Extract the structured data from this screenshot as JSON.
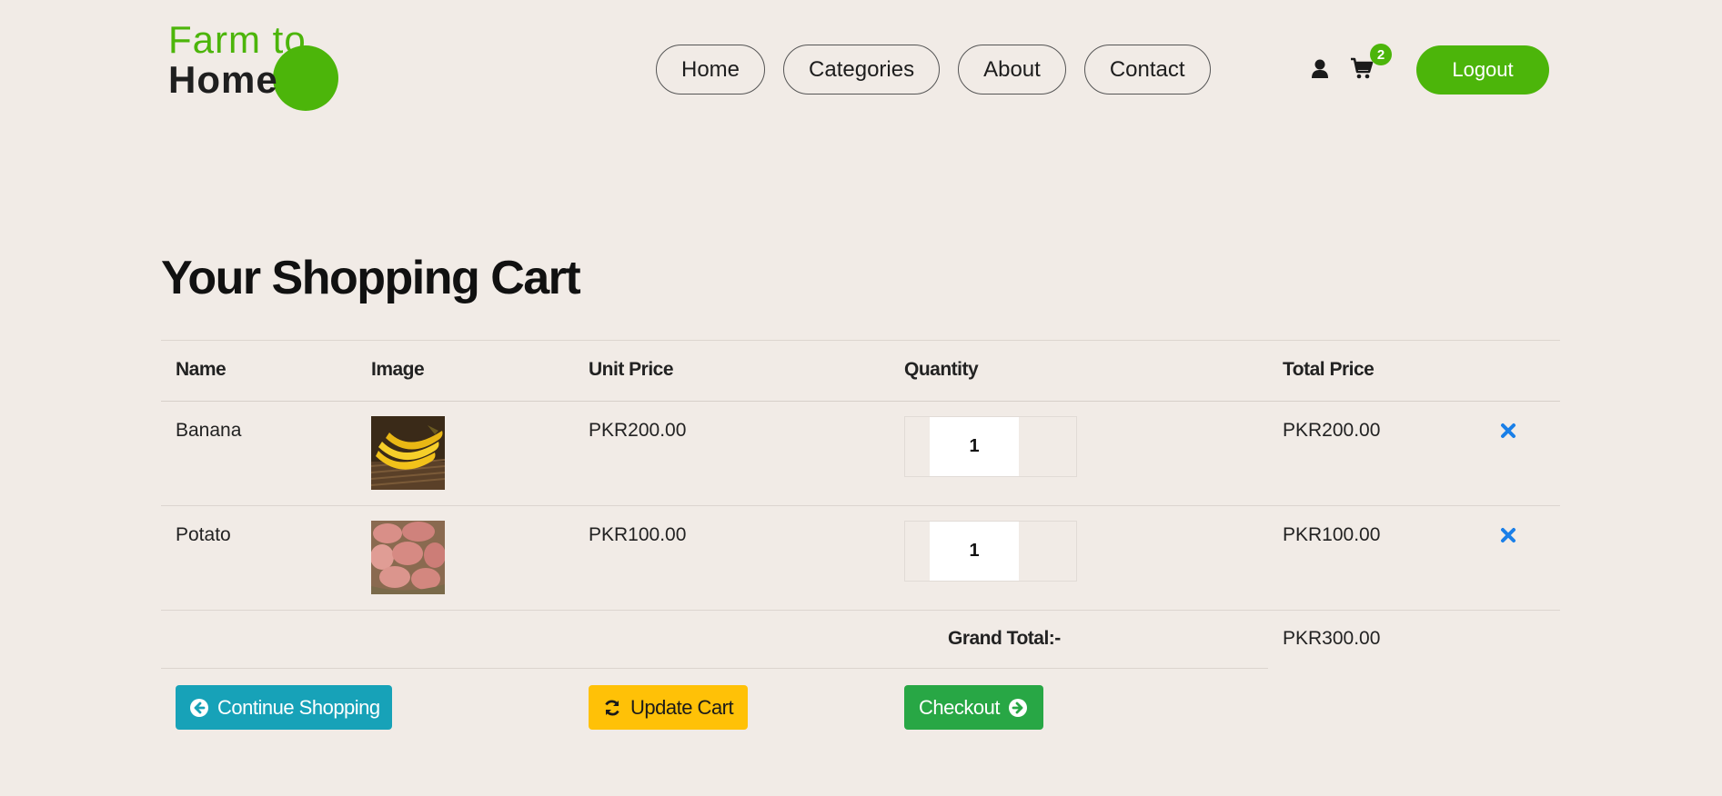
{
  "brand": {
    "line1": "Farm to",
    "line2": "Home",
    "accent": "#4cb50a"
  },
  "nav": {
    "items": [
      {
        "label": "Home"
      },
      {
        "label": "Categories"
      },
      {
        "label": "About"
      },
      {
        "label": "Contact"
      }
    ],
    "cart_count": "2",
    "logout_label": "Logout",
    "icons": [
      "user-icon",
      "cart-icon"
    ]
  },
  "page": {
    "title": "Your Shopping Cart"
  },
  "cart": {
    "headers": {
      "name": "Name",
      "image": "Image",
      "unit_price": "Unit Price",
      "quantity": "Quantity",
      "total_price": "Total Price"
    },
    "items": [
      {
        "name": "Banana",
        "image": "banana",
        "unit_price": "PKR200.00",
        "quantity": "1",
        "total_price": "PKR200.00"
      },
      {
        "name": "Potato",
        "image": "potato",
        "unit_price": "PKR100.00",
        "quantity": "1",
        "total_price": "PKR100.00"
      }
    ],
    "grand_total_label": "Grand Total:-",
    "grand_total": "PKR300.00"
  },
  "actions": {
    "continue_label": "Continue Shopping",
    "update_label": "Update Cart",
    "checkout_label": "Checkout",
    "colors": {
      "continue": "#17a2b8",
      "update": "#ffc107",
      "checkout": "#28a745",
      "remove": "#1a7fe8"
    }
  }
}
